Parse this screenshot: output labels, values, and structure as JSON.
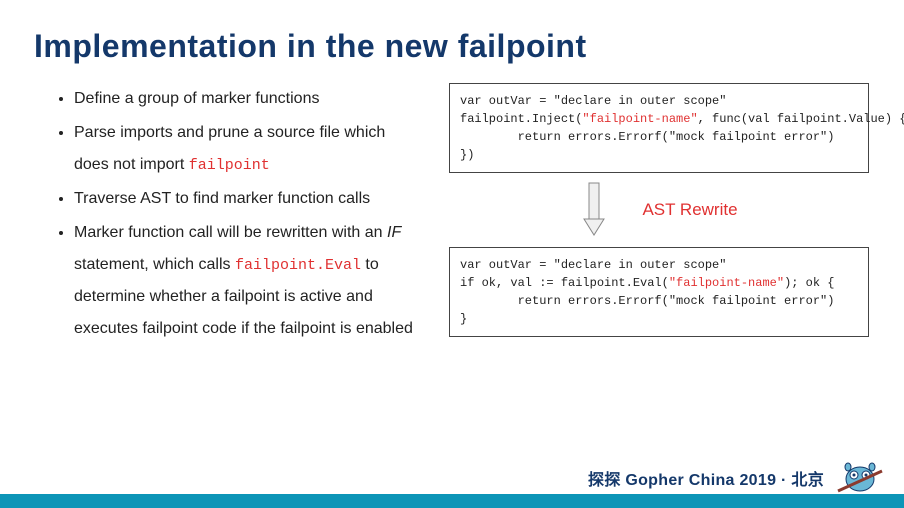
{
  "title": "Implementation in the new failpoint",
  "bullets": {
    "b1": "Define a group of marker functions",
    "b2_a": "Parse imports and prune a source file which does not import ",
    "b2_code": "failpoint",
    "b3": "Traverse AST to find marker function calls",
    "b4_a": "Marker function call will be rewritten with an ",
    "b4_if": "IF",
    "b4_b": " statement, which calls ",
    "b4_code": "failpoint.Eval",
    "b4_c": " to determine whether a failpoint is active and executes failpoint code if the failpoint is enabled"
  },
  "code1": {
    "l1": "var outVar = \"declare in outer scope\"",
    "l2a": "failpoint.Inject(",
    "l2b": "\"failpoint-name\"",
    "l2c": ", func(val failpoint.Value) {",
    "l3": "        return errors.Errorf(\"mock failpoint error\")",
    "l4": "})"
  },
  "arrow_label": "AST Rewrite",
  "code2": {
    "l1": "var outVar = \"declare in outer scope\"",
    "l2a": "if ok, val := failpoint.Eval(",
    "l2b": "\"failpoint-name\"",
    "l2c": "); ok {",
    "l3": "        return errors.Errorf(\"mock failpoint error\")",
    "l4": "}"
  },
  "footer": "探探 Gopher China 2019 · 北京"
}
